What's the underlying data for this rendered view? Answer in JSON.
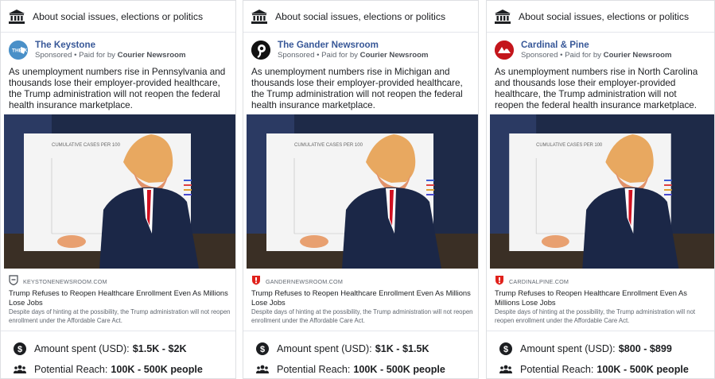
{
  "disclaimer": "About social issues, elections or politics",
  "sponsored_label": "Sponsored • Paid for by",
  "payer": "Courier Newsroom",
  "amount_label": "Amount spent (USD):",
  "reach_label": "Potential Reach:",
  "chart_text": "CUMULATIVE CASES PER 100",
  "icons": {
    "disclaimer": "government-building-icon",
    "domain": "shield-badge-icon",
    "amount": "dollar-coin-icon",
    "reach": "people-group-icon"
  },
  "colors": {
    "page_name": "#385898",
    "shield_gray": "#444950",
    "shield_red": "#e0211b"
  },
  "ads": [
    {
      "page_name": "The Keystone",
      "logo_text": "THE K",
      "body": "As unemployment numbers rise in Pennsylvania and thousands lose their employer-provided healthcare, the Trump administration will not reopen the federal health insurance marketplace.",
      "domain": "KEYSTONENEWSROOM.COM",
      "headline": "Trump Refuses to Reopen Healthcare Enrollment Even As Millions Lose Jobs",
      "description": "Despite days of hinting at the possibility, the Trump administration will not reopen enrollment under the Affordable Care Act.",
      "amount": "$1.5K - $2K",
      "reach": "100K - 500K people"
    },
    {
      "page_name": "The Gander Newsroom",
      "logo_text": "",
      "body": "As unemployment numbers rise in Michigan and thousands lose their employer-provided healthcare, the Trump administration will not reopen the federal health insurance marketplace.",
      "domain": "GANDERNEWSROOM.COM",
      "headline": "Trump Refuses to Reopen Healthcare Enrollment Even As Millions Lose Jobs",
      "description": "Despite days of hinting at the possibility, the Trump administration will not reopen enrollment under the Affordable Care Act.",
      "amount": "$1K - $1.5K",
      "reach": "100K - 500K people"
    },
    {
      "page_name": "Cardinal & Pine",
      "logo_text": "",
      "body": "As unemployment numbers rise in North Carolina and thousands lose their employer-provided healthcare, the Trump administration will not reopen the federal health insurance marketplace.",
      "domain": "CARDINALPINE.COM",
      "headline": "Trump Refuses to Reopen Healthcare Enrollment Even As Millions Lose Jobs",
      "description": "Despite days of hinting at the possibility, the Trump administration will not reopen enrollment under the Affordable Care Act.",
      "amount": "$800 - $899",
      "reach": "100K - 500K people"
    }
  ]
}
